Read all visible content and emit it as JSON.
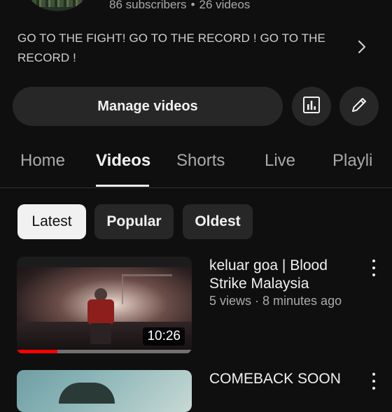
{
  "channel": {
    "subscribers": "86 subscribers",
    "separator": "•",
    "videos_count": "26 videos",
    "description": "GO TO THE FIGHT! GO TO THE RECORD ! GO TO THE RECORD !"
  },
  "actions": {
    "manage_videos_label": "Manage videos",
    "analytics_icon": "bar-chart-icon",
    "edit_icon": "pencil-icon"
  },
  "tabs": [
    {
      "label": "Home",
      "active": false
    },
    {
      "label": "Videos",
      "active": true
    },
    {
      "label": "Shorts",
      "active": false
    },
    {
      "label": "Live",
      "active": false
    },
    {
      "label": "Playli",
      "active": false
    }
  ],
  "chips": [
    {
      "label": "Latest",
      "selected": true
    },
    {
      "label": "Popular",
      "selected": false
    },
    {
      "label": "Oldest",
      "selected": false
    }
  ],
  "videos": [
    {
      "title": "keluar goa | Blood Strike Malaysia",
      "meta": "5 views · 8 minutes ago",
      "duration": "10:26",
      "watched_fraction": 0.23
    },
    {
      "title": "COMEBACK SOON",
      "meta": "",
      "duration": ""
    }
  ],
  "colors": {
    "background": "#0f0f0f",
    "surface": "#272727",
    "text_primary": "#f1f1f1",
    "text_secondary": "#aaaaaa",
    "progress": "#ff0000"
  }
}
